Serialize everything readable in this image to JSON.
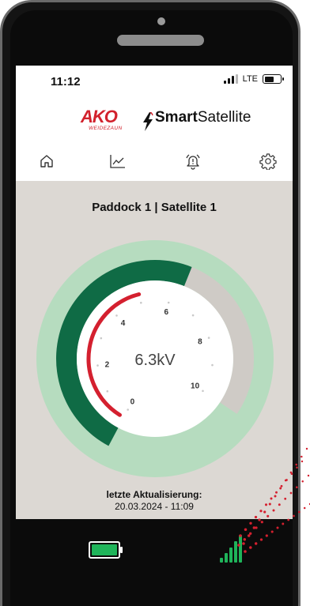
{
  "status_bar": {
    "time": "11:12",
    "network": "LTE",
    "battery_icon": "battery-icon"
  },
  "header": {
    "brand_logo": "AKO",
    "brand_sub": "WEIDEZAUN",
    "app_name_bold": "Smart",
    "app_name_regular": "Satellite",
    "brand_color": "#d2222d"
  },
  "nav": {
    "items": [
      {
        "name": "home",
        "icon": "home-icon"
      },
      {
        "name": "statistics",
        "icon": "chart-icon"
      },
      {
        "name": "alarms",
        "icon": "alarm-bell-icon"
      },
      {
        "name": "settings",
        "icon": "gear-icon"
      }
    ]
  },
  "main": {
    "title": "Paddock 1 | Satellite 1",
    "gauge": {
      "reading": "6.3kV",
      "value": 6.3,
      "min": 0,
      "max": 10,
      "tick_labels": [
        "0",
        "2",
        "4",
        "6",
        "8",
        "10"
      ],
      "colors": {
        "halo": "#b6dcbf",
        "fill": "#0f6b45",
        "track": "#cfcbc6",
        "low_zone": "#d4202f",
        "dial": "#ffffff"
      }
    },
    "last_update_label": "letzte Aktualisierung:",
    "last_update_value": "20.03.2024 - 11:09"
  },
  "device": {
    "battery_icon": "battery-full-icon",
    "battery_color": "#1fb45a",
    "signal_icon": "signal-strength-icon",
    "signal_color": "#1fb45a"
  }
}
